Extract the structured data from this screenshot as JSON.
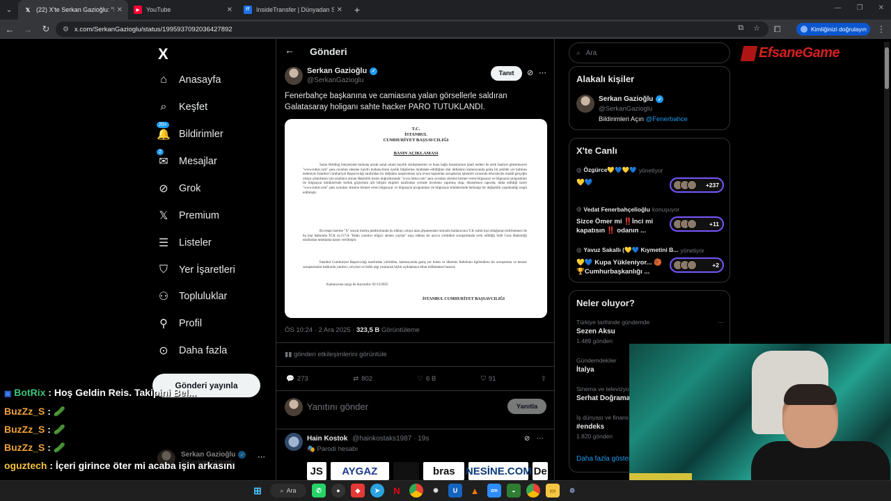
{
  "browser": {
    "tabs": [
      {
        "label": "(22) X'te Serkan Gazioğlu: \"Fenerb",
        "favicon": "X",
        "active": true
      },
      {
        "label": "YouTube",
        "favicon": "▶",
        "active": false
      },
      {
        "label": "InsideTransfer | Dünyadan Son D",
        "favicon": "IT",
        "active": false
      }
    ],
    "url": "x.com/SerkanGazioglu/status/1995937092036427892",
    "profile_pill": "Kimliğinizi doğrulayın"
  },
  "sidebar": {
    "logo": "X",
    "items": [
      {
        "label": "Anasayfa",
        "icon": "home-icon",
        "glyph": "⌂",
        "badge": ""
      },
      {
        "label": "Keşfet",
        "icon": "search-icon",
        "glyph": "⌕",
        "badge": ""
      },
      {
        "label": "Bildirimler",
        "icon": "bell-icon",
        "glyph": "🔔",
        "badge": "20+"
      },
      {
        "label": "Mesajlar",
        "icon": "mail-icon",
        "glyph": "✉",
        "badge": "2"
      },
      {
        "label": "Grok",
        "icon": "grok-icon",
        "glyph": "⊘",
        "badge": ""
      },
      {
        "label": "Premium",
        "icon": "x-premium-icon",
        "glyph": "𝕏",
        "badge": ""
      },
      {
        "label": "Listeler",
        "icon": "list-icon",
        "glyph": "☰",
        "badge": ""
      },
      {
        "label": "Yer İşaretleri",
        "icon": "bookmark-icon",
        "glyph": "⛉",
        "badge": ""
      },
      {
        "label": "Topluluklar",
        "icon": "community-icon",
        "glyph": "⚇",
        "badge": ""
      },
      {
        "label": "Profil",
        "icon": "profile-icon",
        "glyph": "⚲",
        "badge": ""
      },
      {
        "label": "Daha fazla",
        "icon": "more-circle-icon",
        "glyph": "⊙",
        "badge": ""
      }
    ],
    "post_button": "Gönderi yayınla",
    "account": {
      "name": "Serkan Gazioğlu",
      "handle": "@SerkanGazioglu"
    }
  },
  "main": {
    "title": "Gönderi",
    "tweet": {
      "author_name": "Serkan Gazioğlu",
      "author_handle": "@SerkanGazioglu",
      "follow_label": "Tanıt",
      "text": "Fenerbahçe başkanına ve camiasına yalan görsellerle saldıran Galatasaray holiganı sahte hacker PARO TUTUKLANDI.",
      "document": {
        "header1": "T.C.",
        "header2": "İSTANBUL",
        "header3": "CUMHURİYET BAŞSAVCILIĞI",
        "heading": "BASIN AÇIKLAMASI",
        "para1": "Saran Holding bünyesinde bulunan ancak sanal ortam bayilik sözleşmesinin ve buna bağlı lisanslarının iptali nedeni ile artık faaliyet göstermeyen \"www.tuttur.com\" şans oyunları sitesine kayıtlı kullanıcıların üyelik bilgilerine müdahale edildiğine dair iddiaların kamuoyunda geniş bir şekilde yer bulması nedeniyle İstanbul Cumhuriyet Başsavcılığı tarafından bu iddialara araştırılması için re'sen başlatılan soruşturma işlemleri sırasında lehe/aleyhe maddi gerçeğin ortaya çıkarılması için usulünce alınan Hakimlik kararı doğrultusunda \"www.tuttur.com\" şans oyunları sitesine hizmet veren bilgisayar ve bilgisayar programları ile bilgisayar kütüklerinde kolluk güçlerinin alli bilişim ekipleri tarafından yerinde inceleme yapılmış olup, düzenlenen raporda; iddia edildiği üzere \"www.tuttur.com\" şans oyunları sitesine hizmet veren bilgisayar ve bilgisayar programları ile bilgisayar kütüklerinde herhangi bir değişiklik yapılmadığı tespit edilmiştir.",
        "para2": "Bu tespit üzerine \"X\" sosyal medya platformunda bu iddiayı ortaya atan @pameranti rumuzlu kullanıcının Y.K isimli kişi olduğunun belirlenmesi ile bu kişi hakkında TCK m.217/A \"Halkı yanıltıcı bilgiyi alenen yayma\" suçu iddiası ile ayrıca yürütülen soruşturmada sevk edildiği Sulh Ceza Hakimliği tarafından tutuklama kararı verilmiştir.",
        "para3": "İstanbul Cumhuriyet Başsavcılığı tarafından yürütülen, kamuoyunda geniş yer bulan ve ülkemiz futbolunu ilgilendiren bir soruşturma ve benzer soruşturmalar hakkında yanıltıcı, tevyizsi ve farklı algı yaratacak hiçbir açıklamaya itibar edilmemesi hususu;",
        "para4": "Kamuoyuna saygı ile duyurulur. 02/12/2025",
        "signature": "İSTANBUL CUMHURİYET BAŞSAVCILIĞI"
      },
      "time": "ÖS 10:24 · 2 Ara 2025 · ",
      "views_count": "323,5 B",
      "views_label": " Görüntüleme",
      "engagement_link": "gönderi etkileşimlerini görüntüle",
      "replies": "273",
      "reposts": "802",
      "likes": "6 B",
      "bookmarks": "91"
    },
    "reply_placeholder": "Yanıtını gönder",
    "reply_button": "Yanıtla",
    "next_reply": {
      "name": "Hain Kostok",
      "handle": "@hainkostaks1987 · 19s",
      "sub": "Parodi hesabı",
      "ads": [
        "JS",
        "AYGAZ",
        "•",
        "bras",
        "NESİNE.COM",
        "De"
      ]
    }
  },
  "right": {
    "search_placeholder": "Ara",
    "related": {
      "title": "Alakalı kişiler",
      "name": "Serkan Gazioğlu",
      "handle": "@SerkanGazioglu",
      "bio_prefix": "Bildirimleri Açın ",
      "bio_link": "@Fenerbahce"
    },
    "live": {
      "title": "X'te Canlı",
      "rows": [
        {
          "host": "Özgürce💛💙💛💙",
          "role": "yönetiyor",
          "text": "💛💙",
          "count": "+237"
        },
        {
          "host": "Vedat Fenerbahçelioğlu",
          "role": "konuşuyor",
          "text": "Sizce Ömer mi ‼️İnci mi kapatısın ‼️ odanın ...",
          "count": "+11"
        },
        {
          "host": "Yavuz Sakallı (💛💙 Kıymetini B...",
          "role": "yönetiyor",
          "text": "💛💙 Kupa Yükleniyor... 🏀 🏆Cumhurbaşkanlığı ...",
          "count": "+2"
        }
      ]
    },
    "trends": {
      "title": "Neler oluyor?",
      "items": [
        {
          "context": "Türkiye tarihinde gündemde",
          "name": "Sezen Aksu",
          "posts": "1.489 gönderi"
        },
        {
          "context": "Gündemdekiler",
          "name": "İtalya",
          "posts": ""
        },
        {
          "context": "Sinema ve televizyon",
          "name": "Serhat Doğrama",
          "posts": ""
        },
        {
          "context": "İş dünyası ve finans",
          "name": "#endeks",
          "posts": "1.820 gönderi"
        }
      ],
      "show_more": "Daha fazla göster"
    }
  },
  "overlay": {
    "watermark": "EfsaneGame",
    "chat": [
      {
        "user": "BotRix",
        "message": " : Hoş Geldin Reis. Takipini Bel..."
      },
      {
        "user": "BuzZz_S",
        "message": " : 🥒"
      },
      {
        "user": "BuzZz_S",
        "message": " : 🥒"
      },
      {
        "user": "BuzZz_S",
        "message": " : 🥒"
      },
      {
        "user": "oguztech",
        "message": " : İçeri girince öter mi acaba işin arkasını"
      }
    ]
  },
  "taskbar": {
    "search_label": "Ara"
  }
}
